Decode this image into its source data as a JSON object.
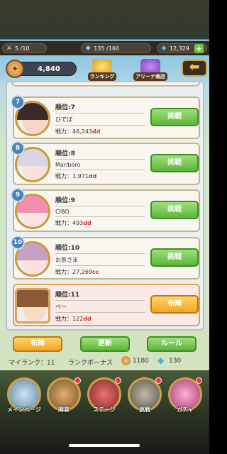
{
  "status": {
    "stamina": "5 /10",
    "gems_energy": "135 /160",
    "diamonds": "12,329",
    "plus": "+"
  },
  "header": {
    "medals": "4,840",
    "ranking_label": "ランキング",
    "arena_shop_label": "アリーナ商店",
    "back_arrow": "⬅"
  },
  "list": [
    {
      "badge": "7",
      "rank": "順位:7",
      "name": "ひでぽ",
      "power_prefix": "戦力：",
      "power": "46,243",
      "suffix": "dd",
      "button": "挑戦",
      "mine": false,
      "hair": "#3a2a2a",
      "face": "#f6d7c6"
    },
    {
      "badge": "8",
      "rank": "順位:8",
      "name": "Marlboro",
      "power_prefix": "戦力：",
      "power": "1,971",
      "suffix": "dd",
      "button": "挑戦",
      "mine": false,
      "hair": "#d9d4e6",
      "face": "#f7e1dd"
    },
    {
      "badge": "9",
      "rank": "順位:9",
      "name": "CIBO",
      "power_prefix": "戦力：",
      "power": "493",
      "suffix": "dd",
      "button": "挑戦",
      "mine": false,
      "hair": "#f18fb0",
      "face": "#fde2e0"
    },
    {
      "badge": "10",
      "rank": "順位:10",
      "name": "お茶さま",
      "power_prefix": "戦力：",
      "power": "27,269",
      "suffix": "cc",
      "button": "挑戦",
      "mine": false,
      "hair": "#c6a0c4",
      "face": "#f8e0dc"
    },
    {
      "badge": "",
      "rank": "順位:11",
      "name": "ペー",
      "power_prefix": "戦力：",
      "power": "122",
      "suffix": "dd",
      "button": "布陣",
      "mine": true,
      "hair": "#8a5a34",
      "face": "#f7dcc4"
    }
  ],
  "actions": {
    "formation": "布陣",
    "refresh": "更新",
    "rules": "ルール"
  },
  "footer": {
    "my_rank": "マイランク：11",
    "rank_bonus": "ランクボーナス",
    "bonus_medals": "1180",
    "bonus_diamonds": "130"
  },
  "nav": [
    {
      "label": "メインページ",
      "icon": "castle-icon",
      "dot": false
    },
    {
      "label": "陣容",
      "icon": "helmet-icon",
      "dot": true
    },
    {
      "label": "ステージ",
      "icon": "stage-icon",
      "dot": true
    },
    {
      "label": "挑戦",
      "icon": "crossed-swords-icon",
      "dot": true
    },
    {
      "label": "ガチャ",
      "icon": "gacha-icon",
      "dot": true
    }
  ]
}
